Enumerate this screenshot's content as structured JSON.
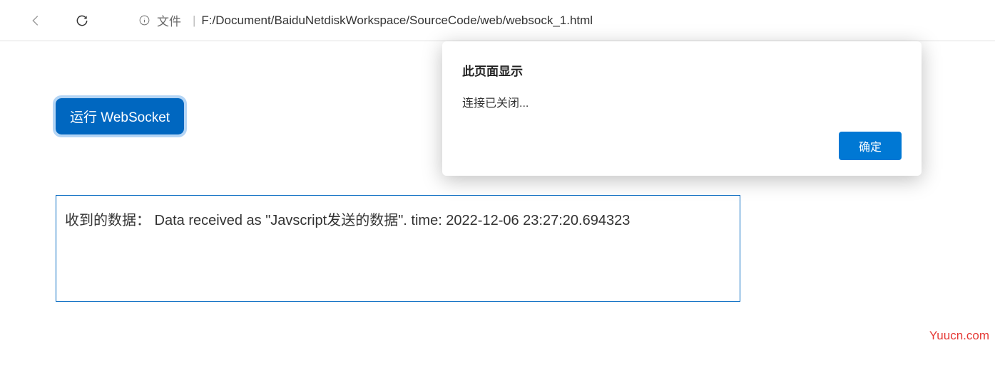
{
  "toolbar": {
    "file_label": "文件",
    "url": "F:/Document/BaiduNetdiskWorkspace/SourceCode/web/websock_1.html"
  },
  "page": {
    "run_button_label": "运行 WebSocket",
    "output_text": "收到的数据： Data received as \"Javscript发送的数据\". time: 2022-12-06 23:27:20.694323"
  },
  "dialog": {
    "title": "此页面显示",
    "message": "连接已关闭...",
    "ok_label": "确定"
  },
  "watermark": "Yuucn.com"
}
